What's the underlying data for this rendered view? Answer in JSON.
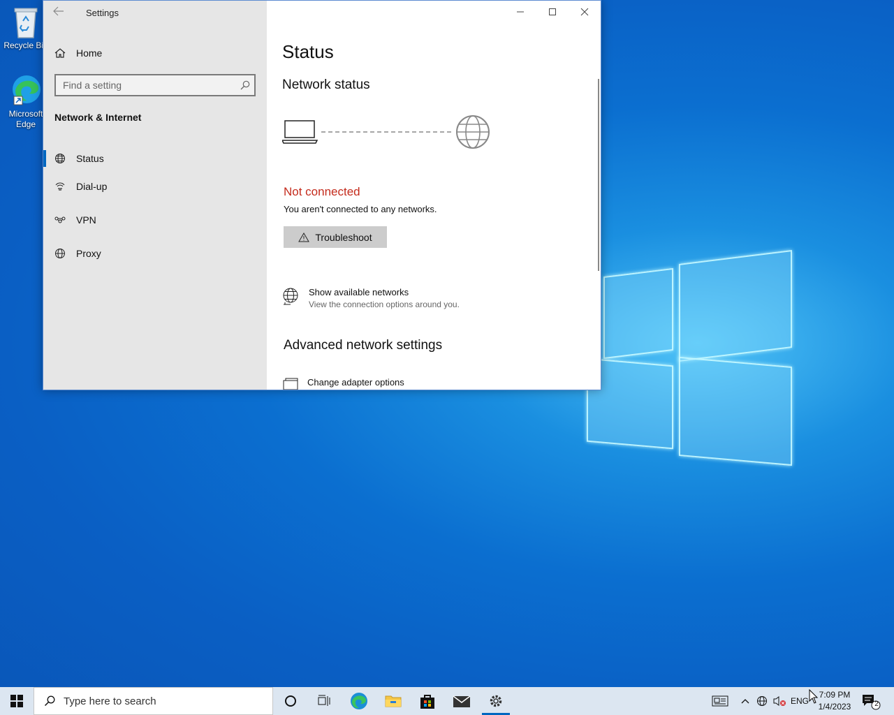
{
  "desktop": {
    "icons": [
      {
        "label": "Recycle Bin",
        "icon": "recycle-bin-icon"
      },
      {
        "label": "Microsoft Edge",
        "icon": "edge-icon"
      }
    ]
  },
  "window": {
    "title": "Settings",
    "sidebar": {
      "home_label": "Home",
      "search_placeholder": "Find a setting",
      "section_title": "Network & Internet",
      "items": [
        {
          "label": "Status",
          "icon": "globe-icon",
          "active": true
        },
        {
          "label": "Dial-up",
          "icon": "dialup-icon",
          "active": false
        },
        {
          "label": "VPN",
          "icon": "vpn-icon",
          "active": false
        },
        {
          "label": "Proxy",
          "icon": "globe-icon",
          "active": false
        }
      ]
    },
    "main": {
      "page_title": "Status",
      "network_status_heading": "Network status",
      "connection_state": "Not connected",
      "connection_desc": "You aren't connected to any networks.",
      "troubleshoot_label": "Troubleshoot",
      "show_networks": {
        "title": "Show available networks",
        "desc": "View the connection options around you."
      },
      "advanced_heading": "Advanced network settings",
      "change_adapter": "Change adapter options"
    }
  },
  "taskbar": {
    "search_placeholder": "Type here to search",
    "language": "ENG",
    "time": "7:09 PM",
    "date": "1/4/2023",
    "notification_count": "2"
  },
  "colors": {
    "accent": "#0067c0",
    "error": "#c42b1c",
    "sidebar_bg": "#e6e6e6",
    "taskbar_bg": "#dce6f1"
  }
}
